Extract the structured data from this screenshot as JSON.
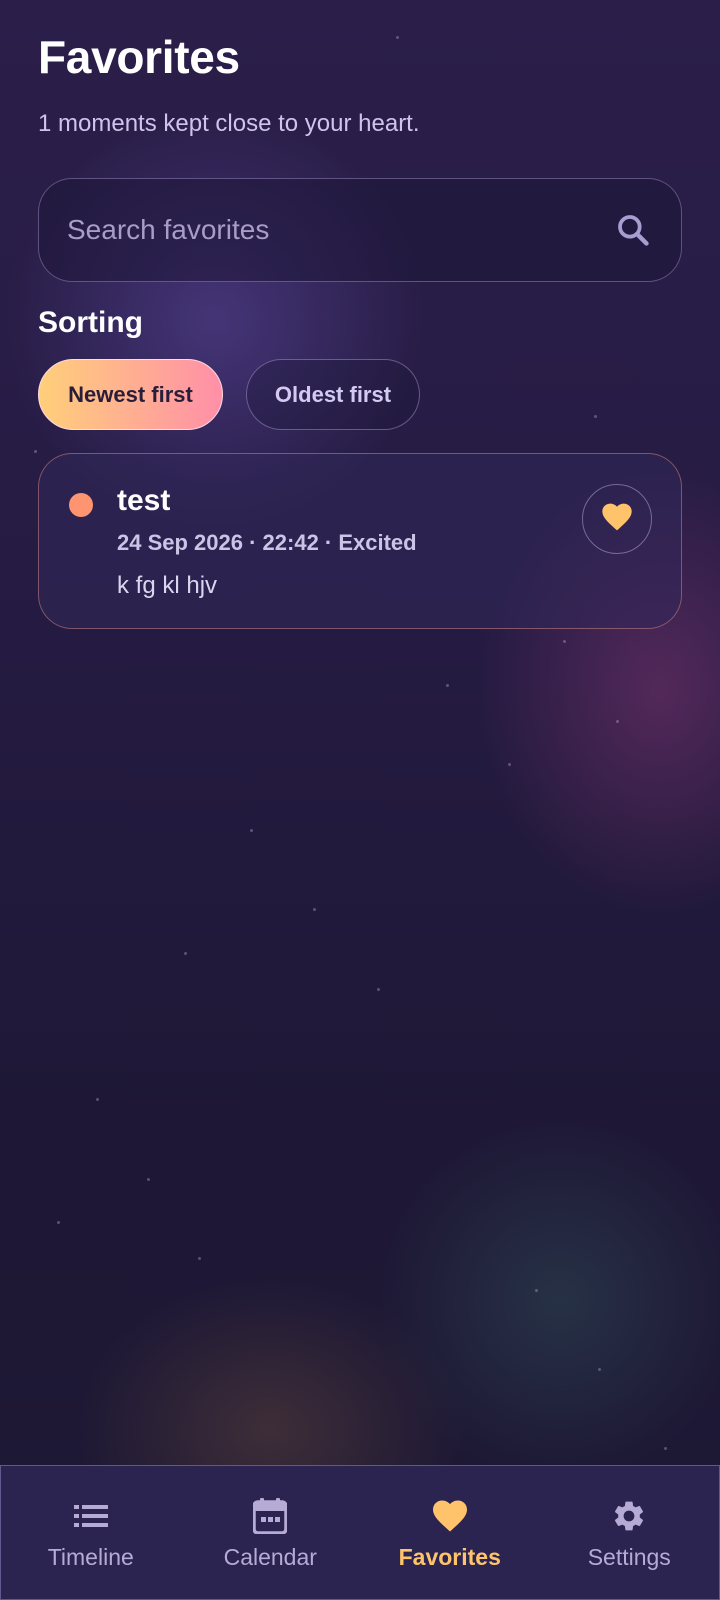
{
  "header": {
    "title": "Favorites",
    "subtitle": "1 moments kept close to your heart."
  },
  "search": {
    "placeholder": "Search favorites",
    "value": "",
    "icon": "search-icon"
  },
  "sorting": {
    "label": "Sorting",
    "options": [
      {
        "label": "Newest first",
        "selected": true
      },
      {
        "label": "Oldest first",
        "selected": false
      }
    ]
  },
  "moments": [
    {
      "title": "test",
      "meta": "24 Sep 2026 · 22:42 · Excited",
      "body": "k fg kl hjv",
      "mood_color": "#ff9470",
      "favorited": true
    }
  ],
  "nav": {
    "items": [
      {
        "label": "Timeline",
        "icon": "list-icon",
        "active": false
      },
      {
        "label": "Calendar",
        "icon": "calendar-icon",
        "active": false
      },
      {
        "label": "Favorites",
        "icon": "heart-icon",
        "active": true
      },
      {
        "label": "Settings",
        "icon": "gear-icon",
        "active": false
      }
    ]
  },
  "colors": {
    "accent": "#ffc46b",
    "chip_gradient_start": "#ffcf7a",
    "chip_gradient_end": "#ff8fa8",
    "background": "#251b42"
  }
}
